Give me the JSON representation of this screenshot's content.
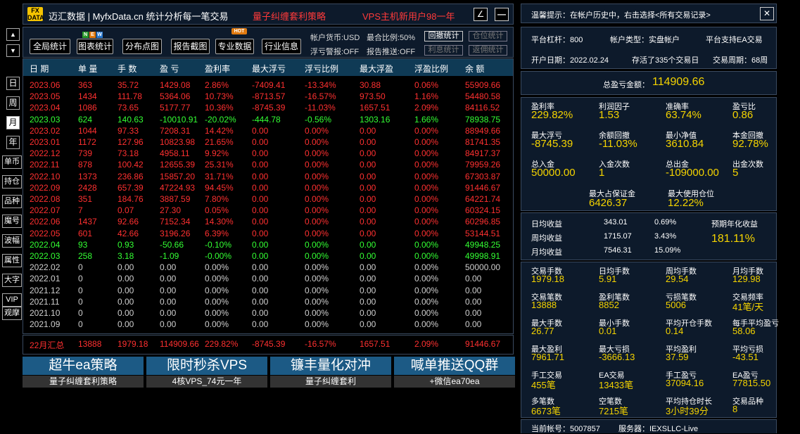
{
  "header": {
    "logo_top": "FX",
    "logo_bottom": "DATA",
    "brand": "迈汇数据 | MyfxData.cn  统计分析每一笔交易",
    "strategy": "量子纠缠套利策略",
    "vps_promo": "VPS主机新用户98一年",
    "edit_icon": "∠",
    "minimize_icon": "—"
  },
  "toolbar": {
    "buttons": [
      "全局统计",
      "图表统计",
      "分布点图",
      "报告截图",
      "专业数据",
      "行业信息"
    ],
    "badge_new": [
      "N",
      "E",
      "W"
    ],
    "badge_hot": "HOT",
    "info": {
      "currency": "帐户货币:USD",
      "hedge": "最合比例:50%",
      "float_alert": "浮亏警报:OFF",
      "report_push": "报告推送:OFF"
    },
    "small_buttons": [
      "回撤统计",
      "仓位统计",
      "利息统计",
      "返佣统计"
    ]
  },
  "sidebar": {
    "up": "▲",
    "down": "▼",
    "period": [
      "日",
      "周",
      "月",
      "年"
    ],
    "tools": [
      "单币",
      "持仓",
      "品种",
      "魔号",
      "波幅",
      "属性",
      "大字",
      "VIP",
      "观摩"
    ]
  },
  "table": {
    "headers": [
      "日 期",
      "单 量",
      "手 数",
      "盈 亏",
      "盈利率",
      "最大浮亏",
      "浮亏比例",
      "最大浮盈",
      "浮盈比例",
      "余 额"
    ],
    "rows": [
      {
        "c": "red",
        "v": [
          "2023.06",
          "363",
          "35.72",
          "1429.08",
          "2.86%",
          "-7409.41",
          "-13.34%",
          "30.88",
          "0.06%",
          "55909.66"
        ]
      },
      {
        "c": "red",
        "v": [
          "2023.05",
          "1434",
          "111.78",
          "5364.06",
          "10.73%",
          "-8713.57",
          "-16.57%",
          "973.50",
          "1.16%",
          "54480.58"
        ]
      },
      {
        "c": "red",
        "v": [
          "2023.04",
          "1086",
          "73.65",
          "5177.77",
          "10.36%",
          "-8745.39",
          "-11.03%",
          "1657.51",
          "2.09%",
          "84116.52"
        ]
      },
      {
        "c": "green",
        "v": [
          "2023.03",
          "624",
          "140.63",
          "-10010.91",
          "-20.02%",
          "-444.78",
          "-0.56%",
          "1303.16",
          "1.66%",
          "78938.75"
        ]
      },
      {
        "c": "red",
        "v": [
          "2023.02",
          "1044",
          "97.33",
          "7208.31",
          "14.42%",
          "0.00",
          "0.00%",
          "0.00",
          "0.00%",
          "88949.66"
        ]
      },
      {
        "c": "red",
        "v": [
          "2023.01",
          "1172",
          "127.96",
          "10823.98",
          "21.65%",
          "0.00",
          "0.00%",
          "0.00",
          "0.00%",
          "81741.35"
        ]
      },
      {
        "c": "red",
        "v": [
          "2022.12",
          "739",
          "73.18",
          "4958.11",
          "9.92%",
          "0.00",
          "0.00%",
          "0.00",
          "0.00%",
          "84917.37"
        ]
      },
      {
        "c": "red",
        "v": [
          "2022.11",
          "878",
          "100.42",
          "12655.39",
          "25.31%",
          "0.00",
          "0.00%",
          "0.00",
          "0.00%",
          "79959.26"
        ]
      },
      {
        "c": "red",
        "v": [
          "2022.10",
          "1373",
          "236.86",
          "15857.20",
          "31.71%",
          "0.00",
          "0.00%",
          "0.00",
          "0.00%",
          "67303.87"
        ]
      },
      {
        "c": "red",
        "v": [
          "2022.09",
          "2428",
          "657.39",
          "47224.93",
          "94.45%",
          "0.00",
          "0.00%",
          "0.00",
          "0.00%",
          "91446.67"
        ]
      },
      {
        "c": "red",
        "v": [
          "2022.08",
          "351",
          "184.76",
          "3887.59",
          "7.80%",
          "0.00",
          "0.00%",
          "0.00",
          "0.00%",
          "64221.74"
        ]
      },
      {
        "c": "red",
        "v": [
          "2022.07",
          "7",
          "0.07",
          "27.30",
          "0.05%",
          "0.00",
          "0.00%",
          "0.00",
          "0.00%",
          "60324.15"
        ]
      },
      {
        "c": "red",
        "v": [
          "2022.06",
          "1437",
          "92.66",
          "7152.34",
          "14.30%",
          "0.00",
          "0.00%",
          "0.00",
          "0.00%",
          "60296.85"
        ]
      },
      {
        "c": "red",
        "v": [
          "2022.05",
          "601",
          "42.66",
          "3196.26",
          "6.39%",
          "0.00",
          "0.00%",
          "0.00",
          "0.00%",
          "53144.51"
        ]
      },
      {
        "c": "green",
        "v": [
          "2022.04",
          "93",
          "0.93",
          "-50.66",
          "-0.10%",
          "0.00",
          "0.00%",
          "0.00",
          "0.00%",
          "49948.25"
        ]
      },
      {
        "c": "green",
        "v": [
          "2022.03",
          "258",
          "3.18",
          "-1.09",
          "-0.00%",
          "0.00",
          "0.00%",
          "0.00",
          "0.00%",
          "49998.91"
        ]
      },
      {
        "c": "gray",
        "v": [
          "2022.02",
          "0",
          "0.00",
          "0.00",
          "0.00%",
          "0.00",
          "0.00%",
          "0.00",
          "0.00%",
          "50000.00"
        ]
      },
      {
        "c": "gray",
        "v": [
          "2022.01",
          "0",
          "0.00",
          "0.00",
          "0.00%",
          "0.00",
          "0.00%",
          "0.00",
          "0.00%",
          "0.00"
        ]
      },
      {
        "c": "gray",
        "v": [
          "2021.12",
          "0",
          "0.00",
          "0.00",
          "0.00%",
          "0.00",
          "0.00%",
          "0.00",
          "0.00%",
          "0.00"
        ]
      },
      {
        "c": "gray",
        "v": [
          "2021.11",
          "0",
          "0.00",
          "0.00",
          "0.00%",
          "0.00",
          "0.00%",
          "0.00",
          "0.00%",
          "0.00"
        ]
      },
      {
        "c": "gray",
        "v": [
          "2021.10",
          "0",
          "0.00",
          "0.00",
          "0.00%",
          "0.00",
          "0.00%",
          "0.00",
          "0.00%",
          "0.00"
        ]
      },
      {
        "c": "gray",
        "v": [
          "2021.09",
          "0",
          "0.00",
          "0.00",
          "0.00%",
          "0.00",
          "0.00%",
          "0.00",
          "0.00%",
          "0.00"
        ]
      }
    ],
    "total": [
      "22月汇总",
      "13888",
      "1979.18",
      "114909.66",
      "229.82%",
      "-8745.39",
      "-16.57%",
      "1657.51",
      "2.09%",
      "91446.67"
    ]
  },
  "ads": [
    {
      "title": "超牛ea策略",
      "sub": "量子纠缠套利策略"
    },
    {
      "title": "限时秒杀VPS",
      "sub": "4核VPS_74元一年"
    },
    {
      "title": "镰丰量化对冲",
      "sub": "量子纠缠套利"
    },
    {
      "title": "喊单推送QQ群",
      "sub": "+微信ea70ea"
    }
  ],
  "right": {
    "tip": "温馨提示：在帐户历史中，右击选择<所有交易记录>",
    "close": "✕",
    "leverage": "平台杠杆：800",
    "account_type": "帐户类型：实盘帐户",
    "ea_support": "平台支持EA交易",
    "open_date": "开户日期：2022.02.24",
    "stored": "存活了335个交易日",
    "cycle": "交易周期：68周",
    "total_label": "总盈亏金额：",
    "total_value": "114909.66",
    "grid1": [
      {
        "l": "盈利率",
        "v": "229.82%"
      },
      {
        "l": "利润因子",
        "v": "1.53"
      },
      {
        "l": "准确率",
        "v": "63.74%"
      },
      {
        "l": "盈亏比",
        "v": "0.86"
      },
      {
        "l": "最大浮亏",
        "v": "-8745.39"
      },
      {
        "l": "余额回撤",
        "v": "-11.03%"
      },
      {
        "l": "最小净值",
        "v": "3610.84"
      },
      {
        "l": "本金回撤",
        "v": "92.78%"
      },
      {
        "l": "总入金",
        "v": "50000.00"
      },
      {
        "l": "入金次数",
        "v": "1"
      },
      {
        "l": "总出金",
        "v": "-109000.00"
      },
      {
        "l": "出金次数",
        "v": "5"
      }
    ],
    "margin_label": "最大占保证金",
    "margin_value": "6426.37",
    "maxpos_label": "最大使用仓位",
    "maxpos_value": "12.22%",
    "avg": [
      {
        "l": "日均收益",
        "v": "343.01",
        "p": "0.69%"
      },
      {
        "l": "周均收益",
        "v": "1715.07",
        "p": "3.43%"
      },
      {
        "l": "月均收益",
        "v": "7546.31",
        "p": "15.09%"
      }
    ],
    "annual_label": "预期年化收益",
    "annual_value": "181.11%",
    "grid2": [
      {
        "l": "交易手数",
        "v": "1979.18"
      },
      {
        "l": "日均手数",
        "v": "5.91"
      },
      {
        "l": "周均手数",
        "v": "29.54"
      },
      {
        "l": "月均手数",
        "v": "129.98"
      },
      {
        "l": "交易笔数",
        "v": "13888"
      },
      {
        "l": "盈利笔数",
        "v": "8852"
      },
      {
        "l": "亏损笔数",
        "v": "5006"
      },
      {
        "l": "交易频率",
        "v": "41笔/天"
      },
      {
        "l": "最大手数",
        "v": "26.77"
      },
      {
        "l": "最小手数",
        "v": "0.01"
      },
      {
        "l": "平均开仓手数",
        "v": "0.14"
      },
      {
        "l": "每手平均盈亏",
        "v": "58.06"
      },
      {
        "l": "最大盈利",
        "v": "7961.71"
      },
      {
        "l": "最大亏损",
        "v": "-3666.13"
      },
      {
        "l": "平均盈利",
        "v": "37.59"
      },
      {
        "l": "平均亏损",
        "v": "-43.51"
      },
      {
        "l": "手工交易",
        "v": "455笔"
      },
      {
        "l": "EA交易",
        "v": "13433笔"
      },
      {
        "l": "手工盈亏",
        "v": "37094.16"
      },
      {
        "l": "EA盈亏",
        "v": "77815.50"
      },
      {
        "l": "多笔数",
        "v": "6673笔"
      },
      {
        "l": "空笔数",
        "v": "7215笔"
      },
      {
        "l": "平均持仓时长",
        "v": "3小时39分"
      },
      {
        "l": "交易品种",
        "v": "8"
      }
    ],
    "account": "当前帐号：5007857",
    "server": "服务器：IEXSLLC-Live"
  }
}
